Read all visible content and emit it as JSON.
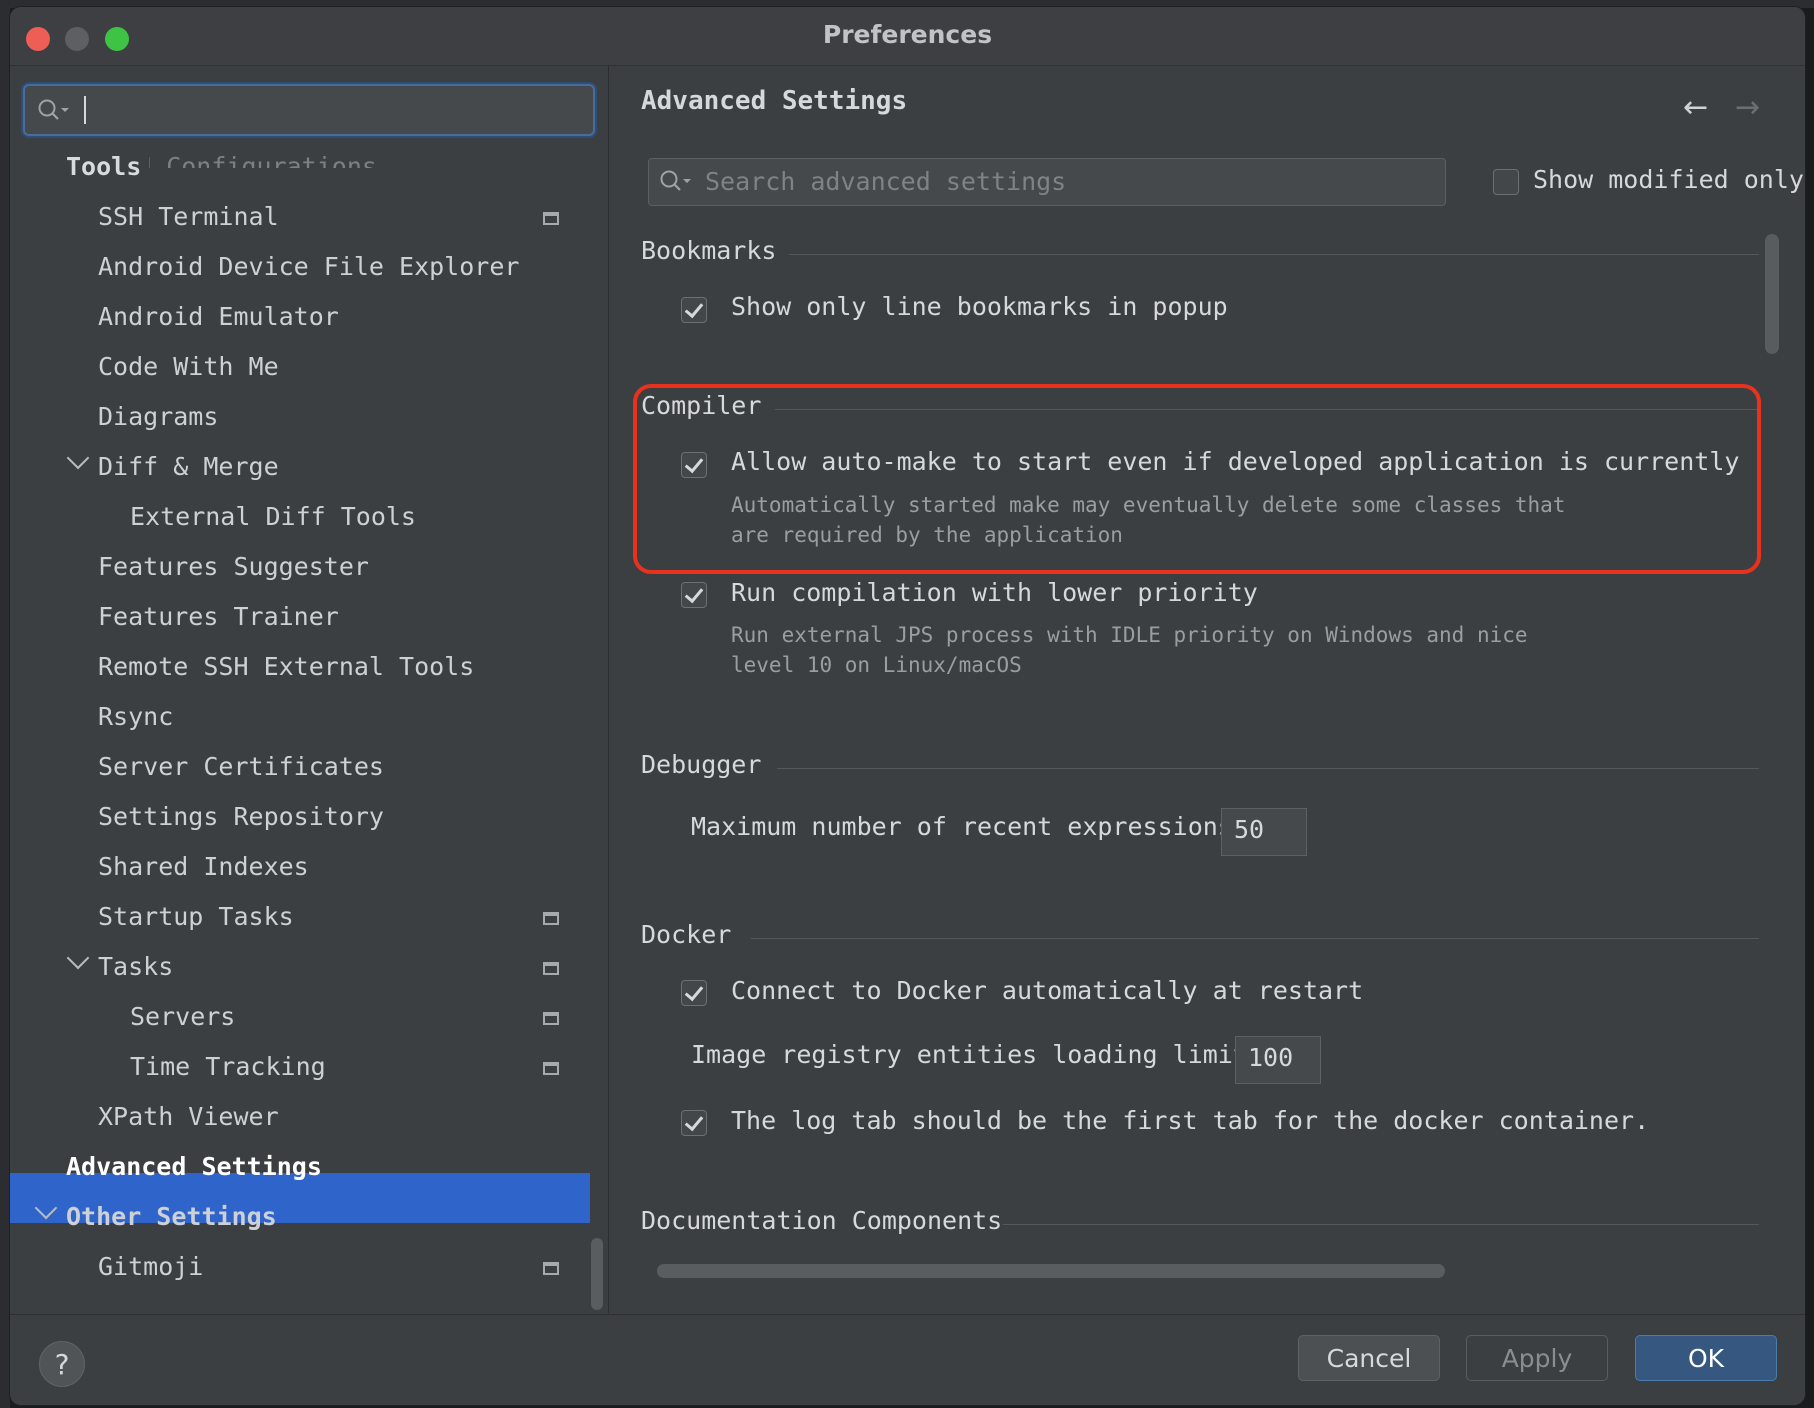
{
  "window": {
    "title": "Preferences"
  },
  "left": {
    "search": {
      "value": ""
    },
    "tools_header": "Tools",
    "cut_item": "SSH Configurations",
    "items": [
      {
        "label": "SSH Terminal",
        "project": true
      },
      {
        "label": "Android Device File Explorer"
      },
      {
        "label": "Android Emulator"
      },
      {
        "label": "Code With Me"
      },
      {
        "label": "Diagrams"
      },
      {
        "label": "Diff & Merge",
        "expanded": true
      },
      {
        "label": "External Diff Tools"
      },
      {
        "label": "Features Suggester"
      },
      {
        "label": "Features Trainer"
      },
      {
        "label": "Remote SSH External Tools"
      },
      {
        "label": "Rsync"
      },
      {
        "label": "Server Certificates"
      },
      {
        "label": "Settings Repository"
      },
      {
        "label": "Shared Indexes"
      },
      {
        "label": "Startup Tasks",
        "project": true
      },
      {
        "label": "Tasks",
        "expanded": true,
        "project": true
      },
      {
        "label": "Servers",
        "project": true
      },
      {
        "label": "Time Tracking",
        "project": true
      },
      {
        "label": "XPath Viewer"
      },
      {
        "label": "Advanced Settings",
        "selected": true
      },
      {
        "label": "Other Settings",
        "expanded": true
      },
      {
        "label": "Gitmoji",
        "project": true
      }
    ]
  },
  "right": {
    "title": "Advanced Settings",
    "search_placeholder": "Search advanced settings",
    "show_modified_only": "Show modified only",
    "sections": {
      "bookmarks": {
        "title": "Bookmarks",
        "option1": "Show only line bookmarks in popup"
      },
      "compiler": {
        "title": "Compiler",
        "option1": "Allow auto-make to start even if developed application is currently running",
        "hint1_line1": "Automatically started make may eventually delete some classes that",
        "hint1_line2": "are required by the application",
        "option2": "Run compilation with lower priority",
        "hint2_line1": "Run external JPS process with IDLE priority on Windows and nice",
        "hint2_line2": "level 10 on Linux/macOS"
      },
      "debugger": {
        "title": "Debugger",
        "label": "Maximum number of recent expressions:",
        "value": "50"
      },
      "docker": {
        "title": "Docker",
        "option1": "Connect to Docker automatically at restart",
        "label": "Image registry entities loading limit:",
        "value": "100",
        "option2": "The log tab should be the first tab for the docker container."
      },
      "documentation": {
        "title": "Documentation Components"
      }
    }
  },
  "buttons": {
    "help": "?",
    "cancel": "Cancel",
    "apply": "Apply",
    "ok": "OK"
  },
  "colors": {
    "selection": "#2f65ca",
    "highlight_box": "#e8321e",
    "ok_button": "#365880"
  }
}
